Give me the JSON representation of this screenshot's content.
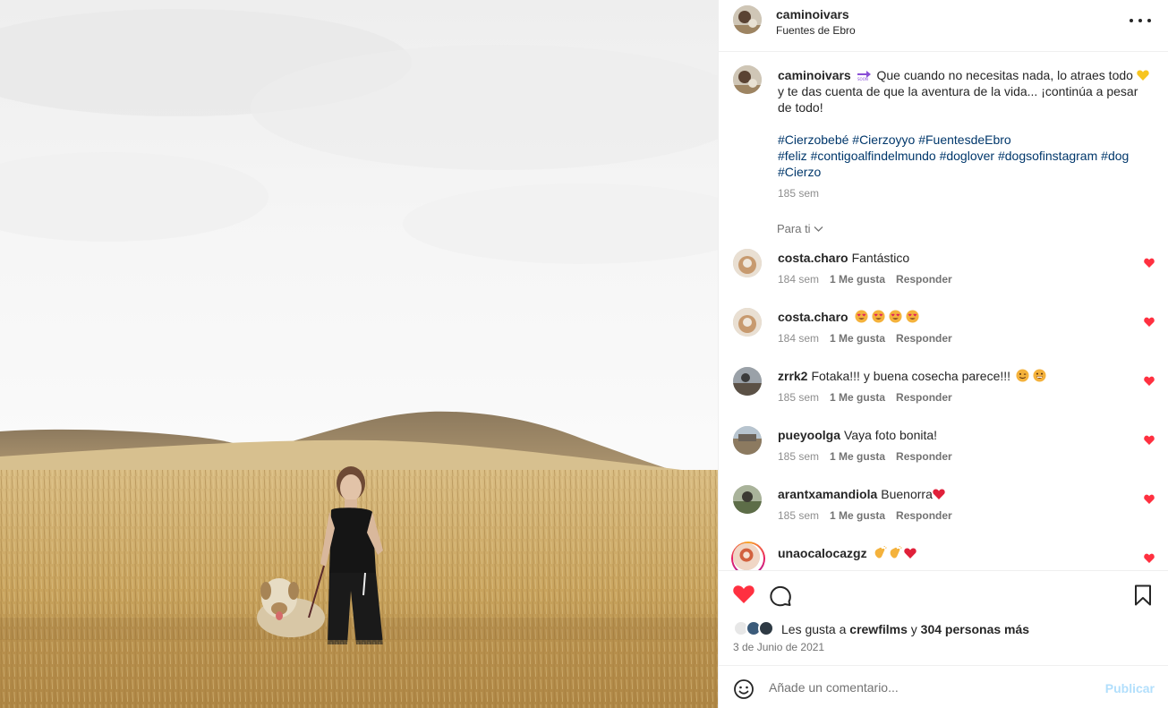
{
  "post": {
    "username": "caminoivars",
    "location": "Fuentes de Ebro"
  },
  "caption": {
    "username": "caminoivars",
    "text_part1": "Que cuando no necesitas nada, lo atraes todo",
    "text_part2": "y te das cuenta de que la aventura de la vida... ¡continúa a pesar de todo!",
    "hashtags": [
      "#Cierzobebé",
      "#Cierzoyyo",
      "#FuentesdeEbro",
      "#feliz",
      "#contigoalfindelmundo",
      "#doglover",
      "#dogsofinstagram",
      "#dog",
      "#Cierzo"
    ],
    "time": "185 sem",
    "icons": [
      "soon-arrow-icon",
      "yellow-heart-icon"
    ]
  },
  "sort_label": "Para ti",
  "comments": [
    {
      "username": "costa.charo",
      "text": "Fantástico",
      "time": "184 sem",
      "likes": "1 Me gusta",
      "reply": "Responder"
    },
    {
      "username": "costa.charo",
      "text": "",
      "time": "184 sem",
      "likes": "1 Me gusta",
      "reply": "Responder",
      "emoji": "heart-eyes x4"
    },
    {
      "username": "zrrk2",
      "text": "Fotaka!!! y buena cosecha parece!!!",
      "time": "185 sem",
      "likes": "1 Me gusta",
      "reply": "Responder",
      "emoji": "wink, grin"
    },
    {
      "username": "pueyoolga",
      "text": "Vaya foto bonita!",
      "time": "185 sem",
      "likes": "1 Me gusta",
      "reply": "Responder"
    },
    {
      "username": "arantxamandiola",
      "text": "Buenorra",
      "time": "185 sem",
      "likes": "1 Me gusta",
      "reply": "Responder",
      "emoji": "red-heart"
    },
    {
      "username": "unaocalocazgz",
      "text": "",
      "emoji": "clap x2, red-heart"
    }
  ],
  "likes": {
    "prefix": "Les gusta a",
    "first_user": "crewfilms",
    "connector": "y",
    "others": "304 personas más"
  },
  "date": "3 de Junio de 2021",
  "add_comment": {
    "placeholder": "Añade un comentario...",
    "publish_label": "Publicar"
  },
  "colors": {
    "like_red": "#ff3040",
    "hashtag_blue": "#00376b",
    "publish_disabled": "#b2dffc",
    "secondary_text": "#8e8e8e"
  }
}
